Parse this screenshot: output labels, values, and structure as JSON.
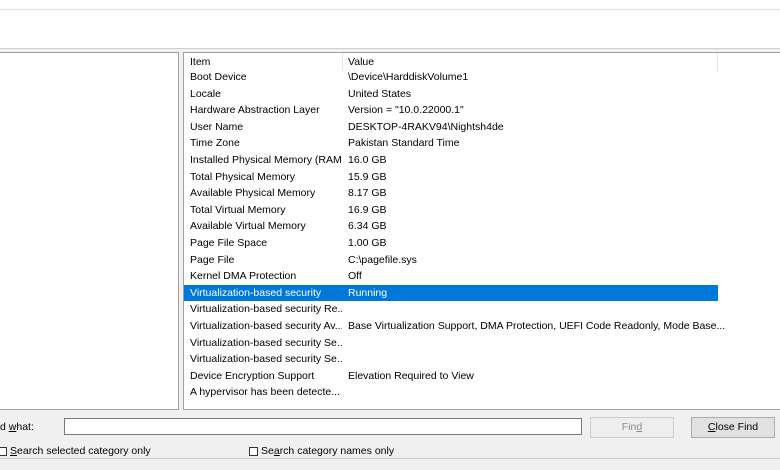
{
  "list": {
    "header": {
      "item": "Item",
      "value": "Value"
    },
    "rows": [
      {
        "item": "Boot Device",
        "value": "\\Device\\HarddiskVolume1"
      },
      {
        "item": "Locale",
        "value": "United States"
      },
      {
        "item": "Hardware Abstraction Layer",
        "value": "Version = \"10.0.22000.1\""
      },
      {
        "item": "User Name",
        "value": "DESKTOP-4RAKV94\\Nightsh4de"
      },
      {
        "item": "Time Zone",
        "value": "Pakistan Standard Time"
      },
      {
        "item": "Installed Physical Memory (RAM)",
        "value": "16.0 GB"
      },
      {
        "item": "Total Physical Memory",
        "value": "15.9 GB"
      },
      {
        "item": "Available Physical Memory",
        "value": "8.17 GB"
      },
      {
        "item": "Total Virtual Memory",
        "value": "16.9 GB"
      },
      {
        "item": "Available Virtual Memory",
        "value": "6.34 GB"
      },
      {
        "item": "Page File Space",
        "value": "1.00 GB"
      },
      {
        "item": "Page File",
        "value": "C:\\pagefile.sys"
      },
      {
        "item": "Kernel DMA Protection",
        "value": "Off"
      },
      {
        "item": "Virtualization-based security",
        "value": "Running",
        "selected": true
      },
      {
        "item": "Virtualization-based security Re...",
        "value": ""
      },
      {
        "item": "Virtualization-based security Av...",
        "value": "Base Virtualization Support, DMA Protection, UEFI Code Readonly, Mode Base..."
      },
      {
        "item": "Virtualization-based security Se...",
        "value": ""
      },
      {
        "item": "Virtualization-based security Se...",
        "value": ""
      },
      {
        "item": "Device Encryption Support",
        "value": "Elevation Required to View"
      },
      {
        "item": "A hypervisor has been detecte...",
        "value": ""
      }
    ]
  },
  "findbar": {
    "label_prefix": "d ",
    "label_accel": "w",
    "label_suffix": "hat:",
    "input_value": "",
    "find_prefix": "Fin",
    "find_accel": "d",
    "close_accel": "C",
    "close_suffix": "lose Find",
    "chk1_accel": "S",
    "chk1_suffix": "earch selected category only",
    "chk2_prefix": "Se",
    "chk2_accel": "a",
    "chk2_suffix": "rch category names only"
  },
  "colors": {
    "selection": "#0078d7"
  }
}
